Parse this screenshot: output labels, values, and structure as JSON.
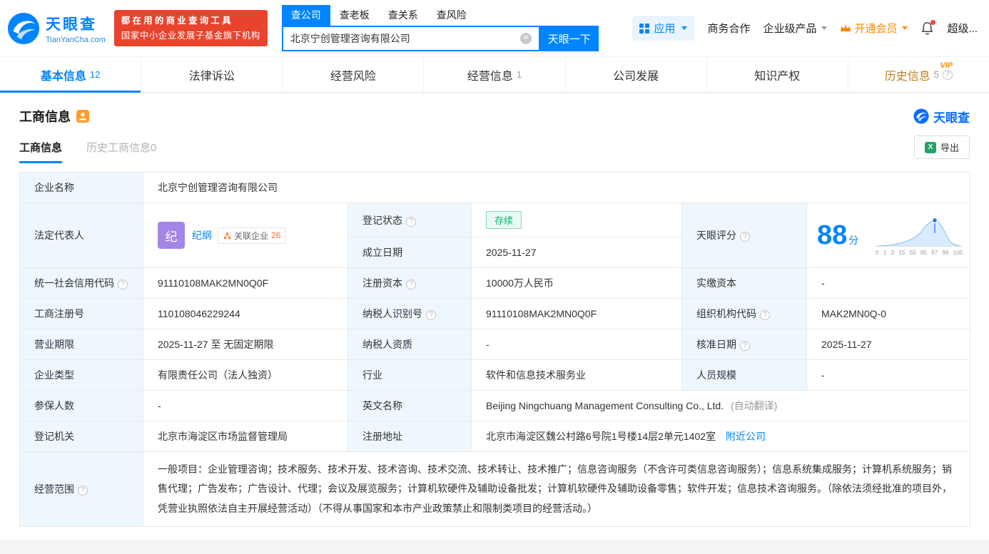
{
  "colors": {
    "brand_blue": "#0084ff",
    "promo_red": "#e8432c",
    "status_green": "#00b368",
    "vip_orange": "#ff8b00",
    "label_cell_bg": "#eef7fe",
    "avatar_purple": "#a585e8"
  },
  "header": {
    "logo": {
      "title": "天眼查",
      "subtitle": "TianYanCha.com"
    },
    "promo": {
      "line1": "都在用的商业查询工具",
      "line2": "国家中小企业发展子基金旗下机构"
    },
    "search": {
      "tabs": [
        {
          "label": "查公司"
        },
        {
          "label": "查老板"
        },
        {
          "label": "查关系"
        },
        {
          "label": "查风险"
        }
      ],
      "value": "北京宁创管理咨询有限公司",
      "button": "天眼一下"
    },
    "menu": {
      "apps": "应用",
      "cooperation": "商务合作",
      "enterprise": "企业级产品",
      "vip": "开通会员",
      "user": "超级..."
    }
  },
  "nav_tabs": [
    {
      "label": "基本信息",
      "count": "12"
    },
    {
      "label": "法律诉讼",
      "count": ""
    },
    {
      "label": "经营风险",
      "count": ""
    },
    {
      "label": "经营信息",
      "count": "1"
    },
    {
      "label": "公司发展",
      "count": ""
    },
    {
      "label": "知识产权",
      "count": ""
    },
    {
      "label": "历史信息",
      "count": "5",
      "badge": "VIP"
    }
  ],
  "section": {
    "title": "工商信息",
    "brand": "天眼查",
    "subtabs": [
      {
        "label": "工商信息"
      },
      {
        "label": "历史工商信息0"
      }
    ],
    "export_label": "导出"
  },
  "info": {
    "company_name": {
      "label": "企业名称",
      "value": "北京宁创管理咨询有限公司"
    },
    "legal_rep": {
      "label": "法定代表人",
      "avatar": "纪",
      "name": "纪纲",
      "related_label": "关联企业",
      "related_count": "26"
    },
    "reg_status": {
      "label": "登记状态",
      "value": "存续"
    },
    "establish_date": {
      "label": "成立日期",
      "value": "2025-11-27"
    },
    "score": {
      "label": "天眼评分",
      "value": "88",
      "unit": "分",
      "ticks": [
        "0",
        "1",
        "3",
        "15",
        "50",
        "85",
        "97",
        "99",
        "100"
      ]
    },
    "credit_code": {
      "label": "统一社会信用代码",
      "value": "91110108MAK2MN0Q0F"
    },
    "reg_capital": {
      "label": "注册资本",
      "value": "10000万人民币"
    },
    "paid_capital": {
      "label": "实缴资本",
      "value": "-"
    },
    "reg_number": {
      "label": "工商注册号",
      "value": "110108046229244"
    },
    "taxpayer_id": {
      "label": "纳税人识别号",
      "value": "91110108MAK2MN0Q0F"
    },
    "org_code": {
      "label": "组织机构代码",
      "value": "MAK2MN0Q-0"
    },
    "business_term": {
      "label": "营业期限",
      "value": "2025-11-27 至 无固定期限"
    },
    "taxpayer_quality": {
      "label": "纳税人资质",
      "value": "-"
    },
    "approval_date": {
      "label": "核准日期",
      "value": "2025-11-27"
    },
    "company_type": {
      "label": "企业类型",
      "value": "有限责任公司（法人独资）"
    },
    "industry": {
      "label": "行业",
      "value": "软件和信息技术服务业"
    },
    "staff_size": {
      "label": "人员规模",
      "value": "-"
    },
    "insured_count": {
      "label": "参保人数",
      "value": "-"
    },
    "english_name": {
      "label": "英文名称",
      "value": "Beijing Ningchuang Management Consulting Co., Ltd.",
      "note": "(自动翻译)"
    },
    "reg_authority": {
      "label": "登记机关",
      "value": "北京市海淀区市场监督管理局"
    },
    "reg_address": {
      "label": "注册地址",
      "value": "北京市海淀区魏公村路6号院1号楼14层2单元1402室",
      "link": "附近公司"
    },
    "business_scope": {
      "label": "经营范围",
      "value": "一般项目：企业管理咨询；技术服务、技术开发、技术咨询、技术交流、技术转让、技术推广；信息咨询服务（不含许可类信息咨询服务）；信息系统集成服务；计算机系统服务；销售代理；广告发布；广告设计、代理；会议及展览服务；计算机软硬件及辅助设备批发；计算机软硬件及辅助设备零售；软件开发；信息技术咨询服务。（除依法须经批准的项目外，凭营业执照依法自主开展经营活动）（不得从事国家和本市产业政策禁止和限制类项目的经营活动。）"
    }
  }
}
